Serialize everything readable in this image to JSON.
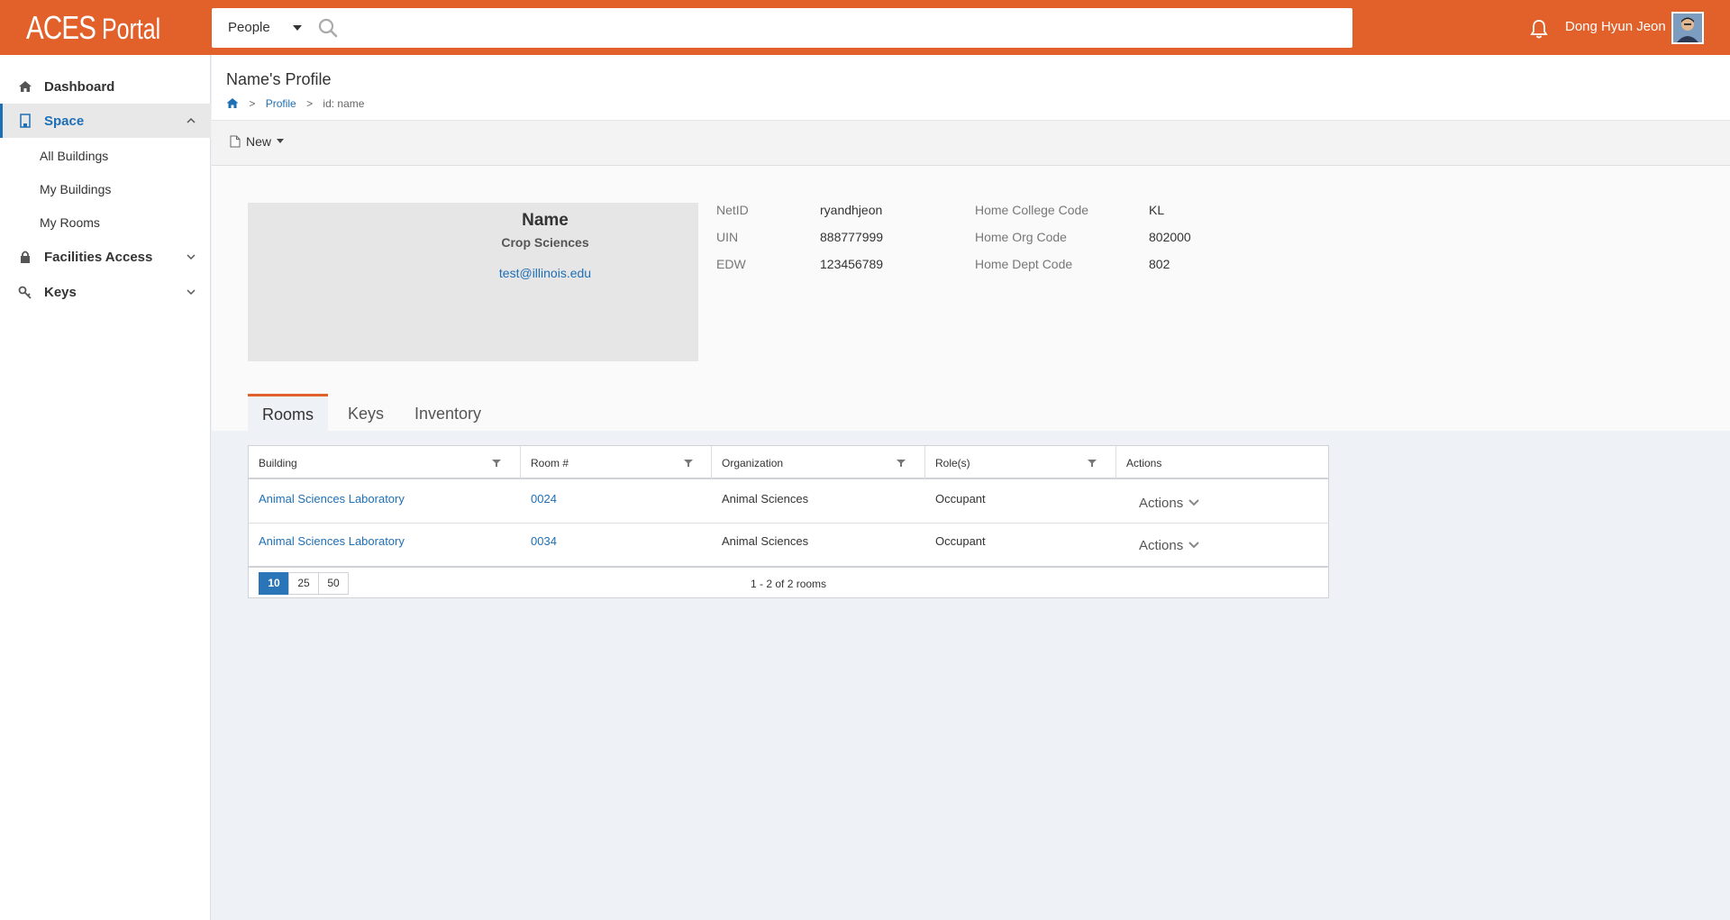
{
  "brand": {
    "main": "ACES",
    "sub": "Portal"
  },
  "search": {
    "scope": "People",
    "placeholder": ""
  },
  "user": {
    "name": "Dong Hyun Jeon"
  },
  "sidebar": {
    "items": [
      {
        "label": "Dashboard"
      },
      {
        "label": "Space"
      },
      {
        "label": "Facilities Access"
      },
      {
        "label": "Keys"
      }
    ],
    "space_sub": [
      "All Buildings",
      "My Buildings",
      "My Rooms"
    ]
  },
  "page": {
    "title": "Name's Profile",
    "breadcrumb": {
      "sep": ">",
      "profile": "Profile",
      "current": "id: name"
    }
  },
  "toolbar": {
    "new_label": "New"
  },
  "profile": {
    "name": "Name",
    "dept": "Crop Sciences",
    "email": "test@illinois.edu",
    "fields_left": [
      {
        "label": "NetID",
        "value": "ryandhjeon"
      },
      {
        "label": "UIN",
        "value": "888777999"
      },
      {
        "label": "EDW",
        "value": "123456789"
      }
    ],
    "fields_right": [
      {
        "label": "Home College Code",
        "value": "KL"
      },
      {
        "label": "Home Org Code",
        "value": "802000"
      },
      {
        "label": "Home Dept Code",
        "value": "802"
      }
    ]
  },
  "tabs": [
    "Rooms",
    "Keys",
    "Inventory"
  ],
  "table": {
    "columns": [
      "Building",
      "Room #",
      "Organization",
      "Role(s)",
      "Actions"
    ],
    "rows": [
      {
        "building": "Animal Sciences Laboratory",
        "room": "0024",
        "org": "Animal Sciences",
        "role": "Occupant",
        "action": "Actions"
      },
      {
        "building": "Animal Sciences Laboratory",
        "room": "0034",
        "org": "Animal Sciences",
        "role": "Occupant",
        "action": "Actions"
      }
    ],
    "page_sizes": [
      "10",
      "25",
      "50"
    ],
    "pager_info": "1 - 2 of 2 rooms"
  },
  "colors": {
    "accent": "#e2612a",
    "link": "#1f6fb5"
  }
}
